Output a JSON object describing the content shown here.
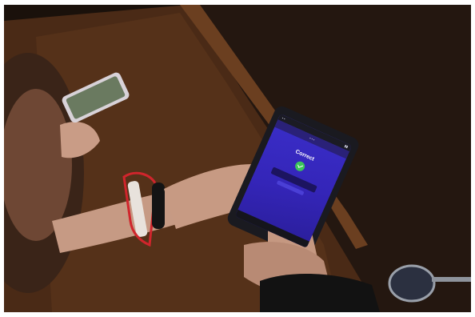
{
  "scene": {
    "phone_screen": {
      "result_title": "Correct",
      "accent": "#3bc45a",
      "screen_color": "#3425b8"
    }
  },
  "icons": [
    "check-icon"
  ]
}
